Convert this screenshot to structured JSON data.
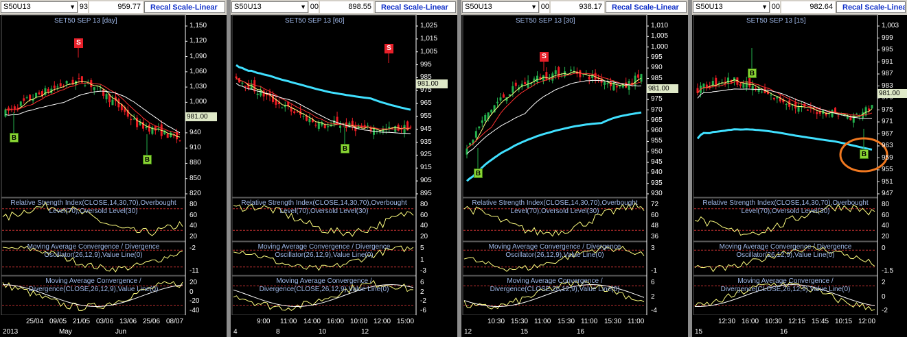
{
  "panels": [
    {
      "symbol": "S50U13",
      "frag": "93",
      "price": "959.77",
      "recal": "Recal Scale-Linear",
      "title": "SET50 SEP 13  [day]",
      "last": "981.00",
      "yticks": [
        "1,150",
        "1,120",
        "1,090",
        "1,060",
        "1,030",
        "1,000",
        "970",
        "940",
        "910",
        "880",
        "850",
        "820"
      ],
      "rsi_ticks": [
        "80",
        "60",
        "40",
        "20"
      ],
      "osc_ticks": [
        "-2",
        "-11"
      ],
      "macd_ticks": [
        "20",
        "0",
        "-20",
        "-40"
      ],
      "xticks": [
        "25/04",
        "09/05",
        "21/05",
        "03/06",
        "13/06",
        "25/06",
        "08/07"
      ],
      "xticks2": [
        "2013",
        "May",
        "Jun"
      ],
      "signals": [
        {
          "t": "S"
        },
        {
          "t": "B"
        },
        {
          "t": "B"
        }
      ]
    },
    {
      "symbol": "S50U13",
      "frag": "00",
      "price": "898.55",
      "recal": "Recal Scale-Linear",
      "title": "SET50 SEP 13  [60]",
      "last": "981.00",
      "yticks": [
        "1,025",
        "1,015",
        "1,005",
        "995",
        "985",
        "975",
        "965",
        "955",
        "945",
        "935",
        "925",
        "915",
        "905",
        "895"
      ],
      "rsi_ticks": [
        "80",
        "60",
        "40",
        "20"
      ],
      "osc_ticks": [
        "5",
        "1",
        "-3"
      ],
      "macd_ticks": [
        "6",
        "2",
        "-2",
        "-6"
      ],
      "xticks": [
        "9:00",
        "11:00",
        "14:00",
        "16:00",
        "10:00",
        "12:00",
        "15:00"
      ],
      "xticks2": [
        "4",
        "8",
        "10",
        "12"
      ],
      "signals": [
        {
          "t": "S"
        },
        {
          "t": "B"
        }
      ]
    },
    {
      "symbol": "S50U13",
      "frag": "00",
      "price": "938.17",
      "recal": "Recal Scale-Linear",
      "title": "SET50 SEP 13  [30]",
      "last": "981.00",
      "yticks": [
        "1,010",
        "1,005",
        "1,000",
        "995",
        "990",
        "985",
        "980",
        "975",
        "970",
        "965",
        "960",
        "955",
        "950",
        "945",
        "940",
        "935",
        "930"
      ],
      "rsi_ticks": [
        "72",
        "60",
        "48",
        "36"
      ],
      "osc_ticks": [
        "3",
        "-1"
      ],
      "macd_ticks": [
        "6",
        "2",
        "-4"
      ],
      "xticks": [
        "10:30",
        "15:30",
        "11:00",
        "15:30",
        "11:00",
        "15:30",
        "11:00"
      ],
      "xticks2": [
        "12",
        "15",
        "16"
      ],
      "signals": [
        {
          "t": "S"
        },
        {
          "t": "B"
        }
      ]
    },
    {
      "symbol": "S50U13",
      "frag": "00",
      "price": "982.64",
      "recal": "Recal Scale-Linear",
      "title": "SET50 SEP 13  [15]",
      "last": "981.00",
      "yticks": [
        "1,003",
        "999",
        "995",
        "991",
        "987",
        "983",
        "979",
        "975",
        "971",
        "967",
        "963",
        "959",
        "955",
        "951",
        "947"
      ],
      "rsi_ticks": [
        "80",
        "60",
        "40",
        "20"
      ],
      "osc_ticks": [
        "0",
        "-1.5"
      ],
      "macd_ticks": [
        "2",
        "0",
        "-2"
      ],
      "xticks": [
        "12:30",
        "16:00",
        "10:30",
        "12:15",
        "15:45",
        "10:15",
        "12:00"
      ],
      "xticks2": [
        "15",
        "16"
      ],
      "signals": [
        {
          "t": "B"
        },
        {
          "t": "B"
        }
      ]
    }
  ],
  "indicators": {
    "rsi": "Relative Strength Index(CLOSE,14,30,70),Overbought Level(70),Oversold Level(30)",
    "osc": "Moving Average Convergence / Divergence Oscillator(26,12,9),Value Line(0)",
    "macd": "Moving Average Convergence / Divergence(CLOSE,26,12,9),Value Line(0)"
  },
  "colors": {
    "up": "#23b14d",
    "down": "#ed1c24",
    "ma_short": "#ffff80",
    "ma_mid": "#ff3030",
    "ma_long": "#ffffff",
    "ma_cyan": "#40e0ff",
    "highlight": "#f07820"
  }
}
